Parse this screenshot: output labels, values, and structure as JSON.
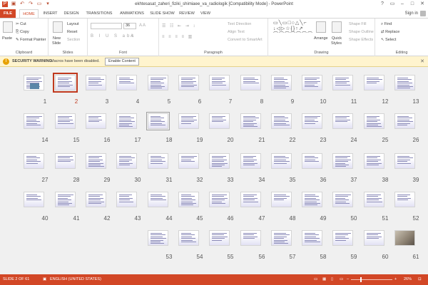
{
  "window": {
    "title": "ekhtesasat_zaheri_fiziki_shimiaee_va_radiologik [Compatibility Mode] - PowerPoint",
    "help": "?",
    "restore": "▭",
    "minimize": "–",
    "maximize": "□",
    "close": "✕"
  },
  "tabs": [
    "FILE",
    "HOME",
    "INSERT",
    "DESIGN",
    "TRANSITIONS",
    "ANIMATIONS",
    "SLIDE SHOW",
    "REVIEW",
    "VIEW"
  ],
  "active_tab": "HOME",
  "signin": "Sign in",
  "ribbon": {
    "clipboard": {
      "paste": "Paste",
      "cut": "Cut",
      "copy": "Copy",
      "format_painter": "Format Painter",
      "label": "Clipboard"
    },
    "slides": {
      "new_slide_1": "New",
      "new_slide_2": "Slide",
      "layout": "Layout",
      "reset": "Reset",
      "section": "Section",
      "label": "Slides"
    },
    "font": {
      "size": "36",
      "label": "Font"
    },
    "paragraph": {
      "text_direction": "Text Direction",
      "align_text": "Align Text",
      "convert_smartart": "Convert to SmartArt",
      "label": "Paragraph"
    },
    "drawing": {
      "arrange": "Arrange",
      "quick_styles_1": "Quick",
      "quick_styles_2": "Styles",
      "shape_fill": "Shape Fill",
      "shape_outline": "Shape Outline",
      "shape_effects": "Shape Effects",
      "label": "Drawing"
    },
    "editing": {
      "find": "Find",
      "replace": "Replace",
      "select": "Select",
      "label": "Editing"
    }
  },
  "security_bar": {
    "title": "SECURITY WARNING",
    "message": "Macros have been disabled.",
    "button": "Enable Content"
  },
  "slides_rows": [
    [
      13,
      12,
      11,
      10,
      9,
      8,
      7,
      6,
      5,
      4,
      3,
      2,
      1
    ],
    [
      26,
      25,
      24,
      23,
      22,
      21,
      20,
      19,
      18,
      17,
      16,
      15,
      14
    ],
    [
      39,
      38,
      37,
      36,
      35,
      34,
      33,
      32,
      31,
      30,
      29,
      28,
      27
    ],
    [
      52,
      51,
      50,
      49,
      48,
      47,
      46,
      45,
      44,
      43,
      42,
      41,
      40
    ],
    [
      61,
      60,
      59,
      58,
      57,
      56,
      55,
      54,
      53
    ]
  ],
  "selected_slide": 2,
  "status": {
    "slide": "SLIDE 2 OF 61",
    "language": "ENGLISH (UNITED STATES)",
    "zoom": "26%",
    "zoom_level": 0.26
  },
  "colors": {
    "accent": "#d24726",
    "selection": "#c0391e",
    "sorter_bg": "#f0f0f0"
  }
}
